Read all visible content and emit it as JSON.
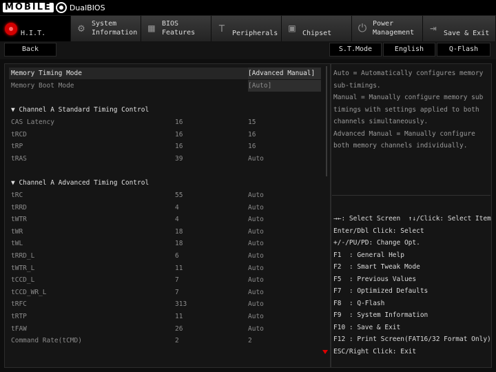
{
  "logo": {
    "brand": "MOBILE",
    "sub": "DualBIOS"
  },
  "tabs": [
    {
      "label": "H.I.T.",
      "icon": "hit-dot-icon",
      "active": true
    },
    {
      "label": "System\nInformation",
      "icon": "gear-icon"
    },
    {
      "label": "BIOS\nFeatures",
      "icon": "chip-grid-icon"
    },
    {
      "label": "Peripherals",
      "icon": "plug-icon"
    },
    {
      "label": "Chipset",
      "icon": "chip-icon"
    },
    {
      "label": "Power\nManagement",
      "icon": "power-icon"
    },
    {
      "label": "Save & Exit",
      "icon": "exit-icon"
    }
  ],
  "subbar": {
    "back": "Back",
    "stmode": "S.T.Mode",
    "language": "English",
    "qflash": "Q-Flash"
  },
  "settings": {
    "memory_timing_mode": {
      "label": "Memory Timing Mode",
      "value": "[Advanced Manual]"
    },
    "memory_boot_mode": {
      "label": "Memory Boot Mode",
      "value": "[Auto]"
    }
  },
  "section_a_standard": "▼ Channel A Standard Timing Control",
  "standard_rows": [
    {
      "label": "CAS Latency",
      "current": "16",
      "setting": "15"
    },
    {
      "label": "tRCD",
      "current": "16",
      "setting": "16"
    },
    {
      "label": "tRP",
      "current": "16",
      "setting": "16"
    },
    {
      "label": "tRAS",
      "current": "39",
      "setting": "Auto"
    }
  ],
  "section_a_advanced": "▼ Channel A Advanced Timing Control",
  "advanced_rows": [
    {
      "label": "tRC",
      "current": "55",
      "setting": "Auto"
    },
    {
      "label": "tRRD",
      "current": "4",
      "setting": "Auto"
    },
    {
      "label": "tWTR",
      "current": "4",
      "setting": "Auto"
    },
    {
      "label": "tWR",
      "current": "18",
      "setting": "Auto"
    },
    {
      "label": "tWL",
      "current": "18",
      "setting": "Auto"
    },
    {
      "label": "tRRD_L",
      "current": "6",
      "setting": "Auto"
    },
    {
      "label": "tWTR_L",
      "current": "11",
      "setting": "Auto"
    },
    {
      "label": "tCCD_L",
      "current": "7",
      "setting": "Auto"
    },
    {
      "label": "tCCD_WR_L",
      "current": "7",
      "setting": "Auto"
    },
    {
      "label": "tRFC",
      "current": "313",
      "setting": "Auto"
    },
    {
      "label": "tRTP",
      "current": "11",
      "setting": "Auto"
    },
    {
      "label": "tFAW",
      "current": "26",
      "setting": "Auto"
    },
    {
      "label": "Command Rate(tCMD)",
      "current": "2",
      "setting": "2"
    }
  ],
  "help_lines": [
    "Auto = Automatically configures memory",
    "sub-timings.",
    "Manual = Manually configure memory sub",
    "timings with settings applied to both",
    "channels simultaneously.",
    "Advanced Manual = Manually configure",
    "both memory channels individually."
  ],
  "key_lines": [
    "→←: Select Screen  ↑↓/Click: Select Item",
    "Enter/Dbl Click: Select",
    "+/-/PU/PD: Change Opt.",
    "F1  : General Help",
    "F2  : Smart Tweak Mode",
    "F5  : Previous Values",
    "F7  : Optimized Defaults",
    "F8  : Q-Flash",
    "F9  : System Information",
    "F10 : Save & Exit",
    "F12 : Print Screen(FAT16/32 Format Only)",
    "ESC/Right Click: Exit"
  ],
  "colors": {
    "accent": "#d40000",
    "background": "#0e0e0e",
    "panel": "#151515"
  }
}
